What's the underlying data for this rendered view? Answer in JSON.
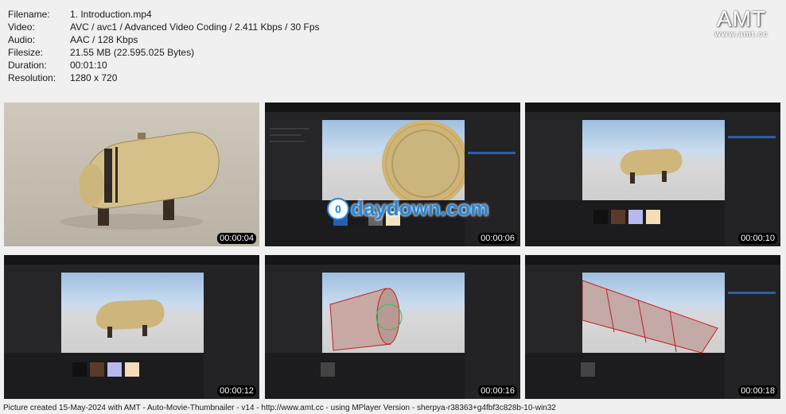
{
  "meta": {
    "rows": [
      {
        "key": "Filename:",
        "value": "1. Introduction.mp4"
      },
      {
        "key": "Video:",
        "value": "AVC / avc1 / Advanced Video Coding / 2.411 Kbps / 30 Fps"
      },
      {
        "key": "Audio:",
        "value": "AAC / 128 Kbps"
      },
      {
        "key": "Filesize:",
        "value": "21.55 MB (22.595.025 Bytes)"
      },
      {
        "key": "Duration:",
        "value": "00:01:10"
      },
      {
        "key": "Resolution:",
        "value": "1280 x 720"
      }
    ]
  },
  "logo": {
    "title": "AMT",
    "url": "www.amt.cc"
  },
  "thumbnails": [
    {
      "timestamp": "00:00:04"
    },
    {
      "timestamp": "00:00:06"
    },
    {
      "timestamp": "00:00:10"
    },
    {
      "timestamp": "00:00:12"
    },
    {
      "timestamp": "00:00:16"
    },
    {
      "timestamp": "00:00:18"
    }
  ],
  "watermark": {
    "icon": "0",
    "text": "daydown.com"
  },
  "footer": "Picture created 15-May-2024 with AMT - Auto-Movie-Thumbnailer - v14 - http://www.amt.cc - using MPlayer Version - sherpya-r38363+g4fbf3c828b-10-win32"
}
